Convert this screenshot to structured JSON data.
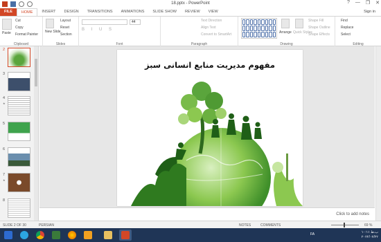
{
  "window": {
    "title": "18.pptx - PowerPoint",
    "controls": [
      "?",
      "—",
      "❐",
      "✕"
    ]
  },
  "tabs": [
    "FILE",
    "HOME",
    "INSERT",
    "DESIGN",
    "TRANSITIONS",
    "ANIMATIONS",
    "SLIDE SHOW",
    "REVIEW",
    "VIEW"
  ],
  "active_tab": "HOME",
  "signin": "Sign in",
  "ribbon": {
    "clipboard": {
      "label": "Clipboard",
      "paste": "Paste",
      "cut": "Cut",
      "copy": "Copy",
      "format_painter": "Format Painter"
    },
    "slides": {
      "label": "Slides",
      "new_slide": "New Slide",
      "layout": "Layout",
      "reset": "Reset",
      "section": "Section"
    },
    "font": {
      "label": "Font",
      "size": "44"
    },
    "paragraph": {
      "label": "Paragraph",
      "text_direction": "Text Direction",
      "align_text": "Align Text",
      "convert_smartart": "Convert to SmartArt"
    },
    "drawing": {
      "label": "Drawing",
      "arrange": "Arrange",
      "quick_styles": "Quick Styles",
      "shape_fill": "Shape Fill",
      "shape_outline": "Shape Outline",
      "shape_effects": "Shape Effects"
    },
    "editing": {
      "label": "Editing",
      "find": "Find",
      "replace": "Replace",
      "select": "Select"
    }
  },
  "thumbnails": [
    {
      "num": "2",
      "selected": true,
      "color": "#5aa53c"
    },
    {
      "num": "3",
      "selected": false,
      "color": "#3d4f6b"
    },
    {
      "num": "4",
      "selected": false,
      "color": "#e9e9e9"
    },
    {
      "num": "5",
      "selected": false,
      "color": "#3fa34d"
    },
    {
      "num": "6",
      "selected": false,
      "color": "#6b8fae"
    },
    {
      "num": "7",
      "selected": false,
      "color": "#7a4a2a"
    },
    {
      "num": "8",
      "selected": false,
      "color": "#eeeeee"
    }
  ],
  "slide": {
    "title": "مفهوم مدیریت منابع انسانی سبز"
  },
  "notes_placeholder": "Click to add notes",
  "status": {
    "slide_of": "SLIDE 2 OF 30",
    "language": "PERSIAN",
    "notes": "NOTES",
    "comments": "COMMENTS",
    "zoom": "69 %"
  },
  "taskbar": {
    "lang": "FA",
    "time": "۱۰:۱۱ ب.ظ",
    "date": "۲۰۲۲/۰۲/۲۲"
  }
}
